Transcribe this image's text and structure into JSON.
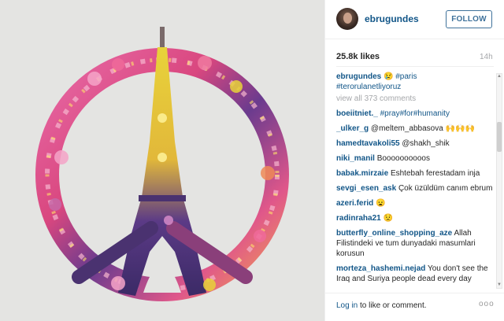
{
  "post": {
    "image_alt_subject": "peace-sign-eiffel-tower-floral",
    "username": "ebrugundes",
    "follow_label": "FOLLOW",
    "likes": "25.8k likes",
    "time": "14h"
  },
  "caption": {
    "user": "ebrugundes",
    "emoji": "😢",
    "text1": "#paris",
    "text2": "#terorulanetliyoruz"
  },
  "view_all": "view all 373 comments",
  "comments": [
    {
      "user": "boeiitniet._",
      "text": "#pray#for#humanity"
    },
    {
      "user": "_ulker_g",
      "text": "@meltem_abbasova 🙌🙌🙌"
    },
    {
      "user": "hamedtavakoli55",
      "text": "@shakh_shik"
    },
    {
      "user": "niki_manil",
      "text": "Boooooooooos"
    },
    {
      "user": "babak.mirzaie",
      "text": "Eshtebah ferestadam inja"
    },
    {
      "user": "sevgi_esen_ask",
      "text": "Çok üzüldüm canım ebrum"
    },
    {
      "user": "azeri.ferid",
      "text": "😦"
    },
    {
      "user": "radinraha21",
      "text": "😟"
    },
    {
      "user": "butterfly_online_shopping_aze",
      "text": "Allah Filistindeki ve tum dunyadaki masumlari korusun"
    },
    {
      "user": "morteza_hashemi.nejad",
      "text": "You don't see the Iraq and Suriya people dead every day"
    }
  ],
  "footer": {
    "login_link": "Log in",
    "login_rest": " to like or comment.",
    "more": "ooo"
  },
  "colors": {
    "link": "#125688",
    "follow": "#3f729b",
    "muted": "#a5a7aa"
  }
}
